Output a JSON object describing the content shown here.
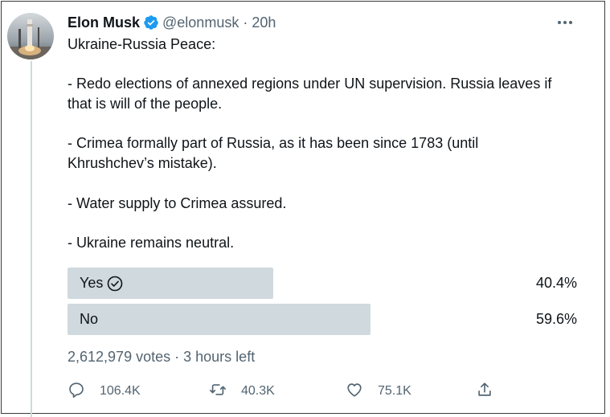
{
  "tweet": {
    "author_name": "Elon Musk",
    "handle": "@elonmusk",
    "separator": "·",
    "time": "20h",
    "text_lines": [
      "Ukraine-Russia Peace:",
      "",
      "- Redo elections of annexed regions under UN supervision. Russia leaves if",
      "that is will of the people.",
      "",
      "- Crimea formally part of Russia, as it has been since 1783 (until",
      "Khrushchev’s mistake).",
      "",
      "- Water supply to Crimea assured.",
      "",
      "- Ukraine remains neutral."
    ]
  },
  "poll": {
    "options": [
      {
        "label": "Yes",
        "percent_text": "40.4%",
        "percent": 40.4,
        "selected": true
      },
      {
        "label": "No",
        "percent_text": "59.6%",
        "percent": 59.6,
        "selected": false
      }
    ],
    "votes": "2,612,979 votes",
    "meta_separator": "·",
    "time_left": "3 hours left"
  },
  "actions": {
    "replies": "106.4K",
    "retweets": "40.3K",
    "likes": "75.1K"
  },
  "colors": {
    "bar": "#cfd9de",
    "verified": "#1d9bf0",
    "muted": "#536471"
  },
  "icons": {
    "verified": "verified-badge-icon",
    "more": "more-dots-icon",
    "check": "check-circle-icon",
    "reply": "reply-icon",
    "retweet": "retweet-icon",
    "like": "like-icon",
    "share": "share-icon"
  }
}
